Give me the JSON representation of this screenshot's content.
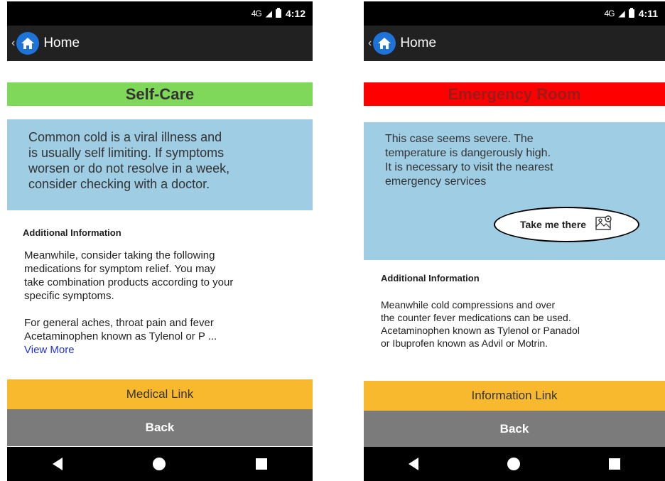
{
  "screens": [
    {
      "status_time": "4:12",
      "signal": "4G",
      "home_label": "Home",
      "triage_label": "Self-Care",
      "triage_color": "#7fd85a",
      "message": [
        "Common cold is a viral illness and",
        "is usually self limiting. If symptoms",
        "worsen or do not resolve in a week,",
        "consider checking with a doctor."
      ],
      "info_title": "Additional Information",
      "info_text": [
        "Meanwhile, consider taking the following",
        "medications for symptom relief. You may",
        "take combination products according to your",
        "specific symptoms.",
        "",
        "For general aches, throat pain and fever",
        "Acetaminophen known as Tylenol or P ..."
      ],
      "view_more": "View More",
      "link_label": "Medical Link",
      "back_label": "Back"
    },
    {
      "status_time": "4:11",
      "signal": "4G",
      "home_label": "Home",
      "triage_label": "Emergency Room",
      "triage_color": "#ff0000",
      "message": [
        "This case seems severe. The",
        "temperature is dangerously high.",
        "It is necessary to visit the nearest",
        "emergency services"
      ],
      "take_me_there": "Take me there",
      "info_title": "Additional Information",
      "info_text": [
        "Meanwhile cold compressions and over",
        "the counter fever medications can be used.",
        "Acetaminophen known as Tylenol or Panadol",
        "or Ibuprofen known as Advil or Motrin."
      ],
      "link_label": "Information Link",
      "back_label": "Back"
    }
  ],
  "icons": [
    "back-chevron-icon",
    "home-icon",
    "signal-icon",
    "battery-icon",
    "map-icon",
    "nav-back-icon",
    "nav-home-icon",
    "nav-recents-icon"
  ]
}
